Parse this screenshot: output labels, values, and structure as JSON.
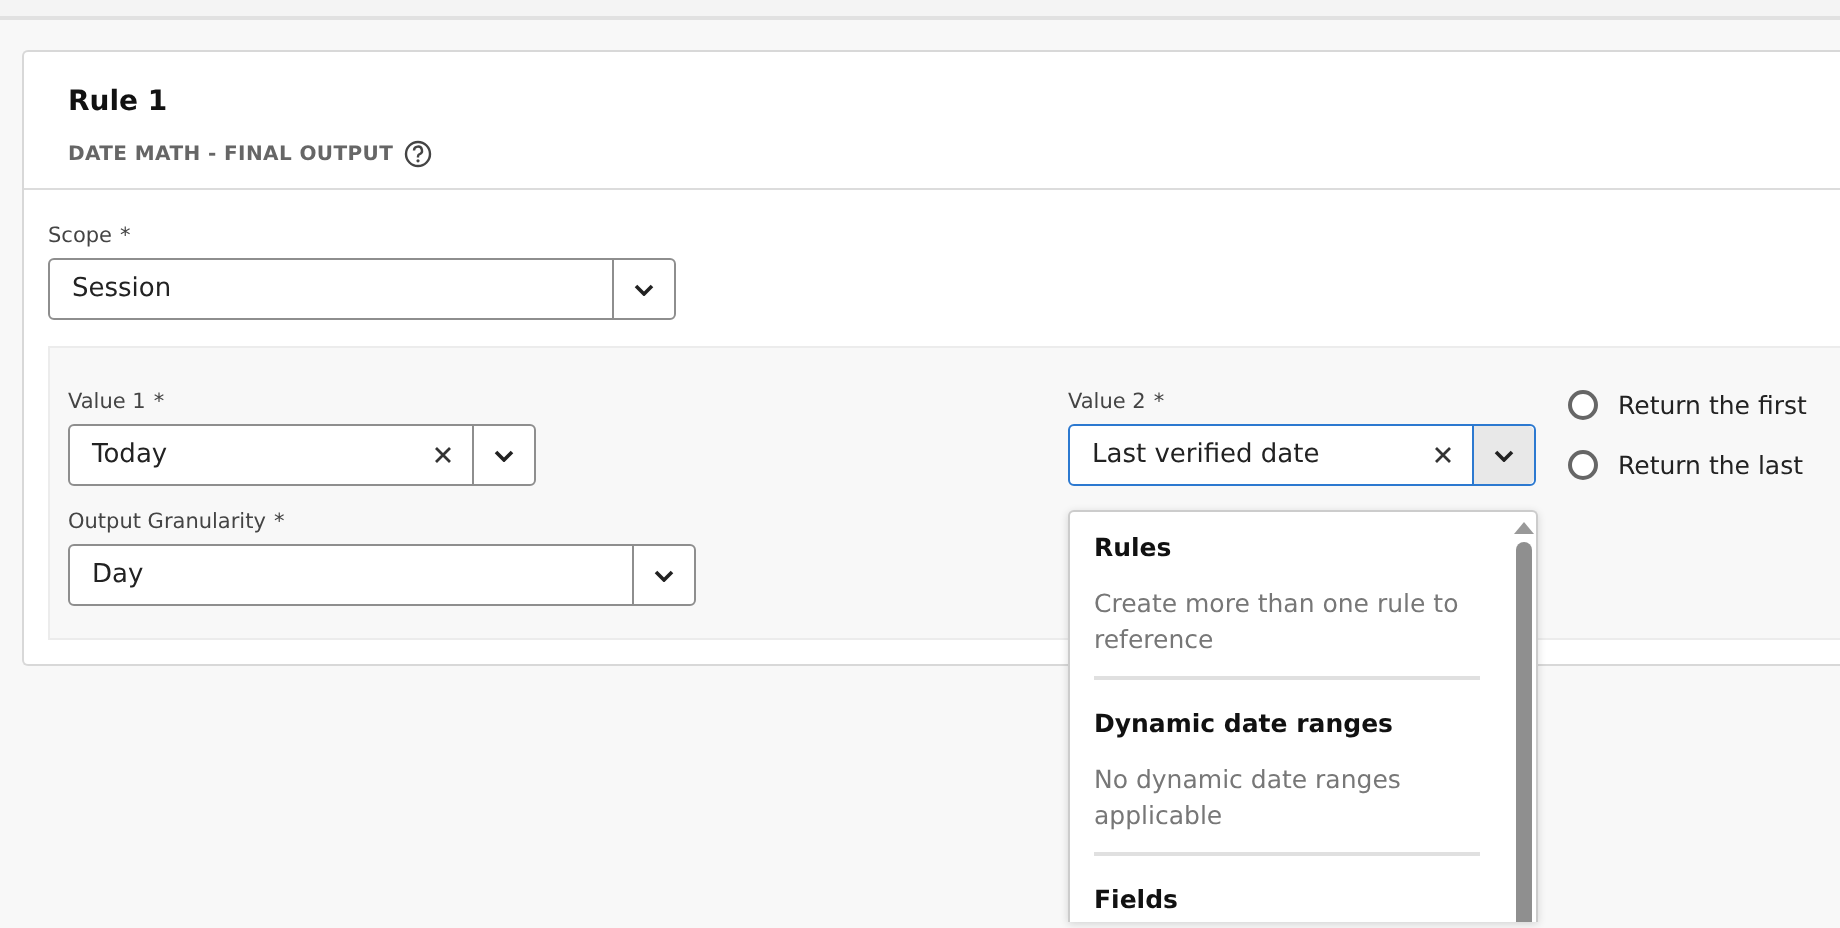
{
  "rule": {
    "title": "Rule 1",
    "subtitle": "DATE MATH - FINAL OUTPUT"
  },
  "scope": {
    "label": "Scope",
    "required_mark": "*",
    "value": "Session"
  },
  "value1": {
    "label": "Value 1",
    "required_mark": "*",
    "value": "Today"
  },
  "granularity": {
    "label": "Output Granularity",
    "required_mark": "*",
    "value": "Day"
  },
  "value2": {
    "label": "Value 2",
    "required_mark": "*",
    "value": "Last verified date",
    "focused": true
  },
  "return_options": [
    {
      "label": "Return the first",
      "selected": false
    },
    {
      "label": "Return the last",
      "selected": false
    }
  ],
  "dropdown": {
    "sections": [
      {
        "title": "Rules",
        "note": "Create more than one rule to reference"
      },
      {
        "title": "Dynamic date ranges",
        "note": "No dynamic date ranges applicable"
      },
      {
        "title": "Fields"
      }
    ]
  }
}
